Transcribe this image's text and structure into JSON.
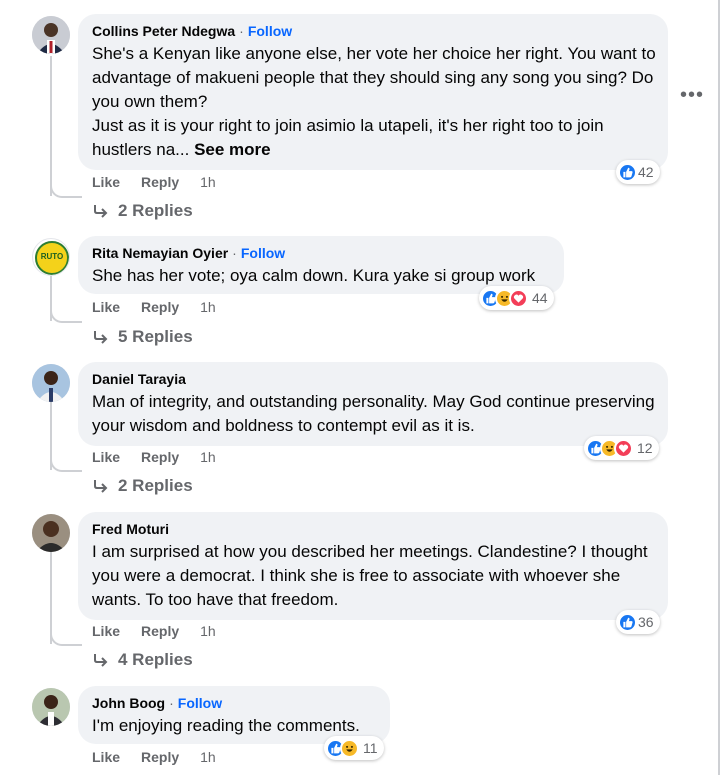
{
  "comments": [
    {
      "author": "Collins Peter Ndegwa",
      "follow": "Follow",
      "text": "She's a Kenyan like anyone else, her vote her choice her right. You want to advantage of makueni people that they should sing any song you sing? Do you own them?\nJust as it is your right to join asimio la utapeli, it's her right too to join hustlers na... ",
      "see_more": "See more",
      "like": "Like",
      "reply": "Reply",
      "time": "1h",
      "reaction_count": "42",
      "reactions": [
        "like-icon"
      ],
      "replies": "2 Replies"
    },
    {
      "author": "Rita Nemayian Oyier",
      "follow": "Follow",
      "text": "She has her vote; oya calm down. Kura yake si group work",
      "like": "Like",
      "reply": "Reply",
      "time": "1h",
      "reaction_count": "44",
      "reactions": [
        "like-icon",
        "haha-icon",
        "love-icon"
      ],
      "replies": "5 Replies",
      "avatar_text": "RUTO"
    },
    {
      "author": "Daniel Tarayia",
      "text": "Man of integrity, and outstanding personality. May God continue preserving your wisdom and boldness to contempt evil as it is.",
      "like": "Like",
      "reply": "Reply",
      "time": "1h",
      "reaction_count": "12",
      "reactions": [
        "like-icon",
        "haha-icon",
        "love-icon"
      ],
      "replies": "2 Replies"
    },
    {
      "author": "Fred Moturi",
      "text": "I am surprised at how you described her meetings. Clandestine? I thought you were a democrat. I think she is free to associate with whoever she wants. To too have that freedom.",
      "like": "Like",
      "reply": "Reply",
      "time": "1h",
      "reaction_count": "36",
      "reactions": [
        "like-icon"
      ],
      "replies": "4 Replies"
    },
    {
      "author": "John Boog",
      "follow": "Follow",
      "text": "I'm enjoying reading the comments.",
      "like": "Like",
      "reply": "Reply",
      "time": "1h",
      "reaction_count": "11",
      "reactions": [
        "like-icon",
        "haha-icon"
      ]
    }
  ],
  "more_options": "•••",
  "colors": {
    "bubble": "#f0f2f5",
    "link": "#0866ff",
    "meta": "#65676b",
    "like": "#1877f2",
    "love": "#f33e58",
    "haha": "#f7b928"
  }
}
